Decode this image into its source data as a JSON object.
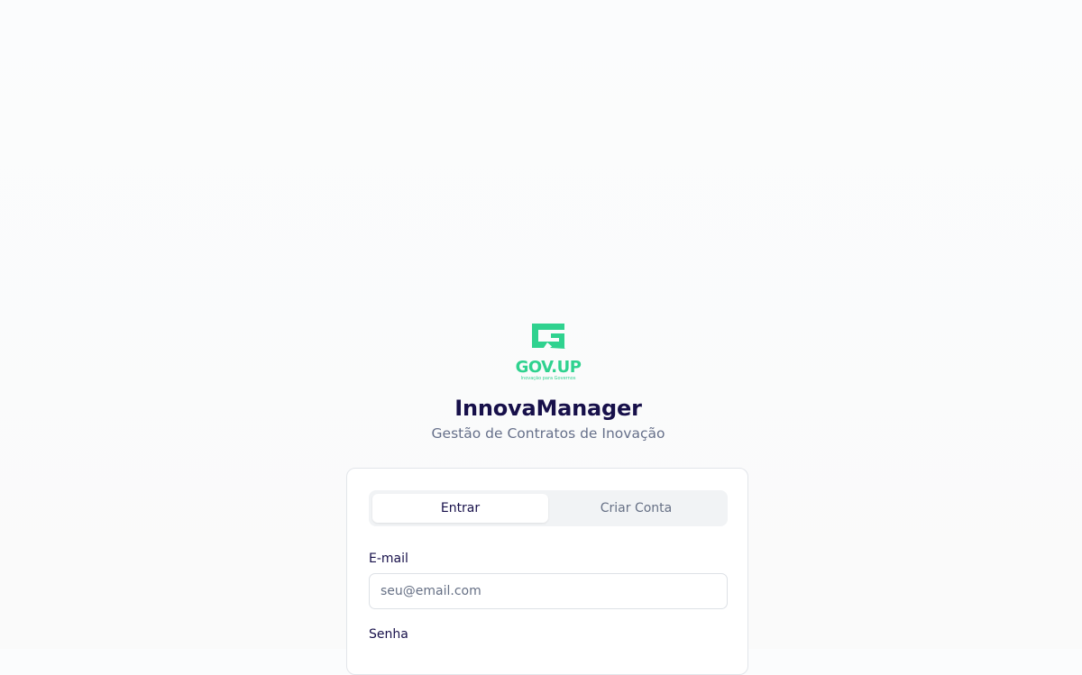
{
  "brand": {
    "logo_text": "GOV.UP",
    "logo_tagline": "Inovação para Governos",
    "logo_color": "#2fd28f"
  },
  "header": {
    "title": "InnovaManager",
    "subtitle": "Gestão de Contratos de Inovação"
  },
  "auth": {
    "tabs": [
      {
        "label": "Entrar",
        "active": true
      },
      {
        "label": "Criar Conta",
        "active": false
      }
    ],
    "email": {
      "label": "E-mail",
      "placeholder": "seu@email.com",
      "value": ""
    },
    "password": {
      "label": "Senha"
    }
  },
  "colors": {
    "title": "#17104a",
    "muted": "#667085",
    "accent": "#2fd28f"
  }
}
